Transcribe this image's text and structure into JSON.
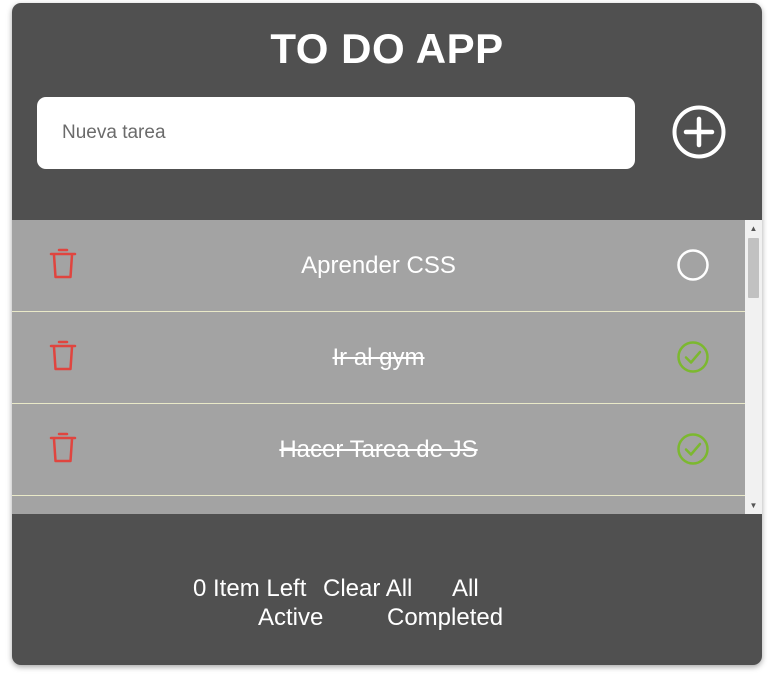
{
  "app": {
    "title": "TO DO APP"
  },
  "input": {
    "placeholder": "Nueva tarea",
    "value": ""
  },
  "add_button": {
    "icon": "plus-circle-icon"
  },
  "tasks": [
    {
      "text": "Aprender CSS",
      "completed": false
    },
    {
      "text": "Ir al gym",
      "completed": true
    },
    {
      "text": "Hacer Tarea de JS",
      "completed": true
    }
  ],
  "footer": {
    "items_left": "0 Item Left",
    "clear_all": "Clear All",
    "filter_all": "All",
    "filter_active": "Active",
    "filter_completed": "Completed"
  },
  "colors": {
    "panel": "#505050",
    "list_bg": "#a3a3a3",
    "trash": "#e0453f",
    "check_done": "#7cb82f",
    "row_divider": "#e9e9c8"
  }
}
